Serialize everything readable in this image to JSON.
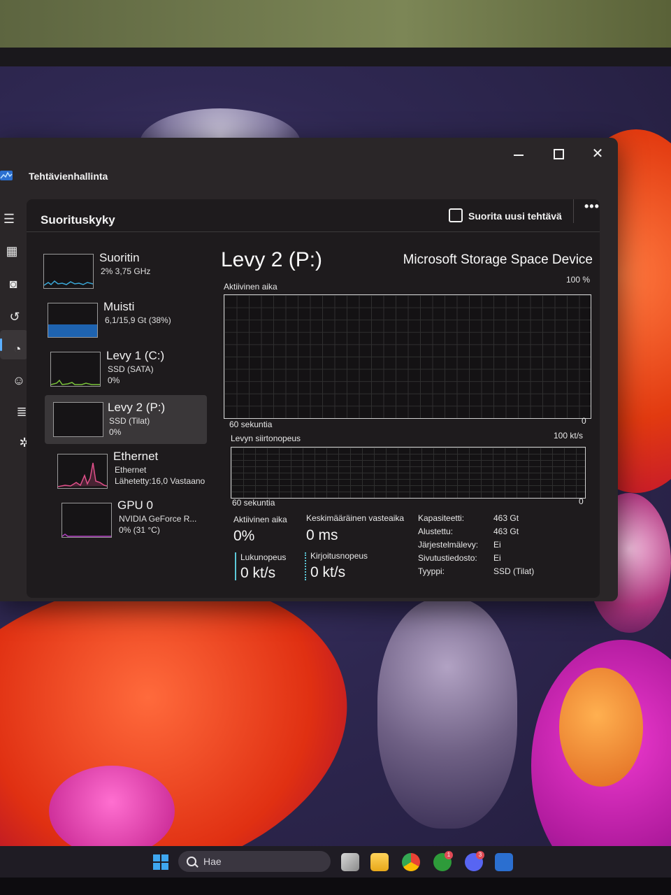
{
  "window": {
    "title": "Tehtävienhallinta",
    "controls": {
      "close": "✕"
    }
  },
  "header": {
    "page_title": "Suorituskyky",
    "run_task_label": "Suorita uusi tehtävä",
    "more_label": "•••"
  },
  "devices": [
    {
      "name": "Suoritin",
      "line1": "2% 3,75 GHz",
      "line2": ""
    },
    {
      "name": "Muisti",
      "line1": "6,1/15,9 Gt (38%)",
      "line2": "",
      "fill": 0.38
    },
    {
      "name": "Levy 1 (C:)",
      "line1": "SSD (SATA)",
      "line2": "0%"
    },
    {
      "name": "Levy 2 (P:)",
      "line1": "SSD (Tilat)",
      "line2": "0%"
    },
    {
      "name": "Ethernet",
      "line1": "Ethernet",
      "line2": "Lähetetty:16,0 Vastaano"
    },
    {
      "name": "GPU 0",
      "line1": "NVIDIA GeForce R...",
      "line2": "0% (31 °C)"
    }
  ],
  "detail": {
    "title": "Levy 2 (P:)",
    "model": "Microsoft Storage Space Device",
    "graph1": {
      "label": "Aktiivinen aika",
      "max": "100 %",
      "time": "60 sekuntia",
      "min": "0"
    },
    "graph2": {
      "label": "Levyn siirtonopeus",
      "max": "100 kt/s",
      "time": "60 sekuntia",
      "min": "0"
    },
    "stats": {
      "active_time_label": "Aktiivinen aika",
      "active_time_value": "0%",
      "avg_response_label": "Keskimääräinen vasteaika",
      "avg_response_value": "0 ms",
      "read_label": "Lukunopeus",
      "read_value": "0 kt/s",
      "write_label": "Kirjoitusnopeus",
      "write_value": "0 kt/s"
    },
    "properties": [
      {
        "key": "Kapasiteetti:",
        "value": "463 Gt"
      },
      {
        "key": "Alustettu:",
        "value": "463 Gt"
      },
      {
        "key": "Järjestelmälevy:",
        "value": "Ei"
      },
      {
        "key": "Sivutustiedosto:",
        "value": "Ei"
      },
      {
        "key": "Tyyppi:",
        "value": "SSD (Tilat)"
      }
    ]
  },
  "taskbar": {
    "search_label": "Hae",
    "badges": {
      "xbox": "1",
      "discord": "3"
    }
  },
  "colors": {
    "accent": "#5cb0ff",
    "cpu_graph": "#3aa8d8",
    "memory_graph": "#1e63b0",
    "disk1_graph": "#7ac43a",
    "ethernet_graph": "#e0508a",
    "gpu_graph": "#b040c0"
  }
}
